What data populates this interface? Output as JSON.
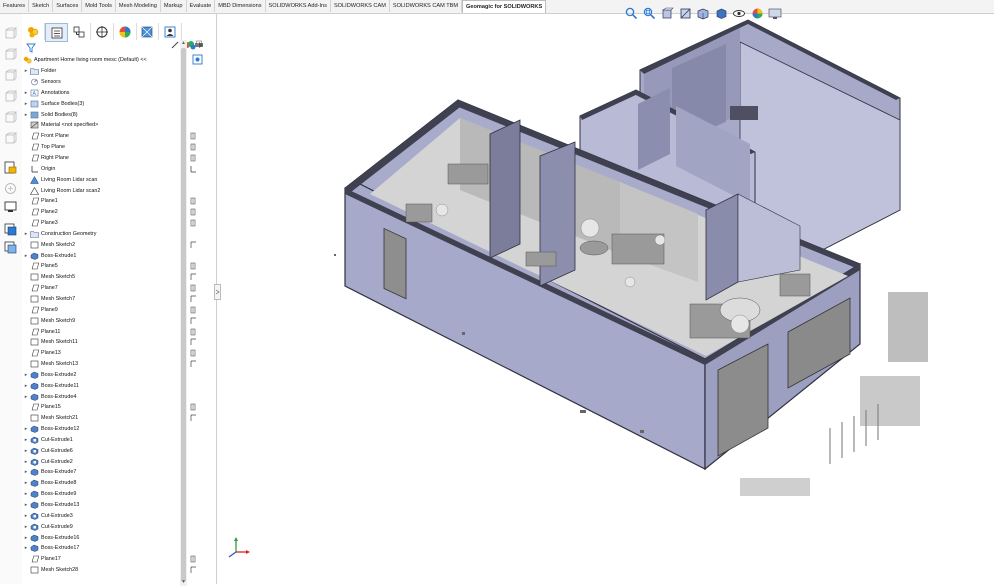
{
  "tabs": [
    {
      "label": "Features"
    },
    {
      "label": "Sketch"
    },
    {
      "label": "Surfaces"
    },
    {
      "label": "Mold Tools"
    },
    {
      "label": "Mesh Modeling"
    },
    {
      "label": "Markup"
    },
    {
      "label": "Evaluate"
    },
    {
      "label": "MBD Dimensions"
    },
    {
      "label": "SOLIDWORKS Add-Ins"
    },
    {
      "label": "SOLIDWORKS CAM"
    },
    {
      "label": "SOLIDWORKS CAM TBM"
    },
    {
      "label": "Geomagic for SOLIDWORKS"
    }
  ],
  "active_tab": "Geomagic for SOLIDWORKS",
  "hud_icons": [
    "zoom-to-fit-icon",
    "zoom-area-icon",
    "previous-view-icon",
    "section-view-icon",
    "view-orientation-icon",
    "display-style-icon",
    "hide-show-icon",
    "edit-appearance-icon",
    "apply-scene-icon",
    "view-settings-icon"
  ],
  "feature_tree": {
    "root": "Apartment Home living room mesc (Default) <<",
    "items": [
      {
        "label": "Folder",
        "icon": "folder-icon",
        "expand": true,
        "mark": ""
      },
      {
        "label": "Sensors",
        "icon": "sensor-icon",
        "expand": false,
        "mark": ""
      },
      {
        "label": "Annotations",
        "icon": "annotation-icon",
        "expand": true,
        "mark": ""
      },
      {
        "label": "Surface Bodies(3)",
        "icon": "surface-bodies-icon",
        "expand": true,
        "mark": ""
      },
      {
        "label": "Solid Bodies(8)",
        "icon": "solid-bodies-icon",
        "expand": true,
        "mark": ""
      },
      {
        "label": "Material <not specified>",
        "icon": "material-icon",
        "expand": false,
        "mark": ""
      },
      {
        "label": "Front Plane",
        "icon": "plane-icon",
        "expand": false,
        "mark": "plane"
      },
      {
        "label": "Top Plane",
        "icon": "plane-icon",
        "expand": false,
        "mark": "plane"
      },
      {
        "label": "Right Plane",
        "icon": "plane-icon",
        "expand": false,
        "mark": "plane"
      },
      {
        "label": "Origin",
        "icon": "origin-icon",
        "expand": false,
        "mark": "origin"
      },
      {
        "label": "Living Room Lidar scan",
        "icon": "mesh-icon",
        "expand": false,
        "mark": ""
      },
      {
        "label": "Living Room Lidar scan2",
        "icon": "mesh-outline-icon",
        "expand": false,
        "mark": ""
      },
      {
        "label": "Plane1",
        "icon": "plane-icon",
        "expand": false,
        "mark": "plane"
      },
      {
        "label": "Plane2",
        "icon": "plane-icon",
        "expand": false,
        "mark": "plane"
      },
      {
        "label": "Plane3",
        "icon": "plane-icon",
        "expand": false,
        "mark": "plane"
      },
      {
        "label": "Construction Geometry",
        "icon": "folder-icon",
        "expand": true,
        "mark": ""
      },
      {
        "label": "Mesh Sketch2",
        "icon": "sketch-icon",
        "expand": false,
        "mark": "sketch"
      },
      {
        "label": "Boss-Extrude1",
        "icon": "extrude-icon",
        "expand": true,
        "mark": ""
      },
      {
        "label": "Plane5",
        "icon": "plane-icon",
        "expand": false,
        "mark": "plane"
      },
      {
        "label": "Mesh Sketch5",
        "icon": "sketch-icon",
        "expand": false,
        "mark": "sketch"
      },
      {
        "label": "Plane7",
        "icon": "plane-icon",
        "expand": false,
        "mark": "plane"
      },
      {
        "label": "Mesh Sketch7",
        "icon": "sketch-icon",
        "expand": false,
        "mark": "sketch"
      },
      {
        "label": "Plane9",
        "icon": "plane-icon",
        "expand": false,
        "mark": "plane"
      },
      {
        "label": "Mesh Sketch9",
        "icon": "sketch-icon",
        "expand": false,
        "mark": "sketch"
      },
      {
        "label": "Plane11",
        "icon": "plane-icon",
        "expand": false,
        "mark": "plane"
      },
      {
        "label": "Mesh Sketch11",
        "icon": "sketch-icon",
        "expand": false,
        "mark": "sketch"
      },
      {
        "label": "Plane13",
        "icon": "plane-icon",
        "expand": false,
        "mark": "plane"
      },
      {
        "label": "Mesh Sketch13",
        "icon": "sketch-icon",
        "expand": false,
        "mark": "sketch"
      },
      {
        "label": "Boss-Extrude2",
        "icon": "extrude-icon",
        "expand": true,
        "mark": ""
      },
      {
        "label": "Boss-Extrude11",
        "icon": "extrude-icon",
        "expand": true,
        "mark": ""
      },
      {
        "label": "Boss-Extrude4",
        "icon": "extrude-icon",
        "expand": true,
        "mark": ""
      },
      {
        "label": "Plane15",
        "icon": "plane-icon",
        "expand": false,
        "mark": "plane"
      },
      {
        "label": "Mesh Sketch21",
        "icon": "sketch-icon",
        "expand": false,
        "mark": "sketch"
      },
      {
        "label": "Boss-Extrude12",
        "icon": "extrude-icon",
        "expand": true,
        "mark": ""
      },
      {
        "label": "Cut-Extrude1",
        "icon": "cut-icon",
        "expand": true,
        "mark": ""
      },
      {
        "label": "Cut-Extrude6",
        "icon": "cut-icon",
        "expand": true,
        "mark": ""
      },
      {
        "label": "Cut-Extrude2",
        "icon": "cut-icon",
        "expand": true,
        "mark": ""
      },
      {
        "label": "Boss-Extrude7",
        "icon": "extrude-icon",
        "expand": true,
        "mark": ""
      },
      {
        "label": "Boss-Extrude8",
        "icon": "extrude-icon",
        "expand": true,
        "mark": ""
      },
      {
        "label": "Boss-Extrude9",
        "icon": "extrude-icon",
        "expand": true,
        "mark": ""
      },
      {
        "label": "Boss-Extrude13",
        "icon": "extrude-icon",
        "expand": true,
        "mark": ""
      },
      {
        "label": "Cut-Extrude3",
        "icon": "cut-icon",
        "expand": true,
        "mark": ""
      },
      {
        "label": "Cut-Extrude9",
        "icon": "cut-icon",
        "expand": true,
        "mark": ""
      },
      {
        "label": "Boss-Extrude16",
        "icon": "extrude-icon",
        "expand": true,
        "mark": ""
      },
      {
        "label": "Boss-Extrude17",
        "icon": "extrude-icon",
        "expand": true,
        "mark": ""
      },
      {
        "label": "Plane17",
        "icon": "plane-icon",
        "expand": false,
        "mark": "plane"
      },
      {
        "label": "Mesh Sketch28",
        "icon": "sketch-icon",
        "expand": false,
        "mark": "sketch"
      }
    ]
  },
  "colors": {
    "wall": "#a9abcb",
    "wall_dark": "#3f4050",
    "floor": "#d6d6d6",
    "interior": "#c8c8c8",
    "accent": "#2b79d0"
  }
}
